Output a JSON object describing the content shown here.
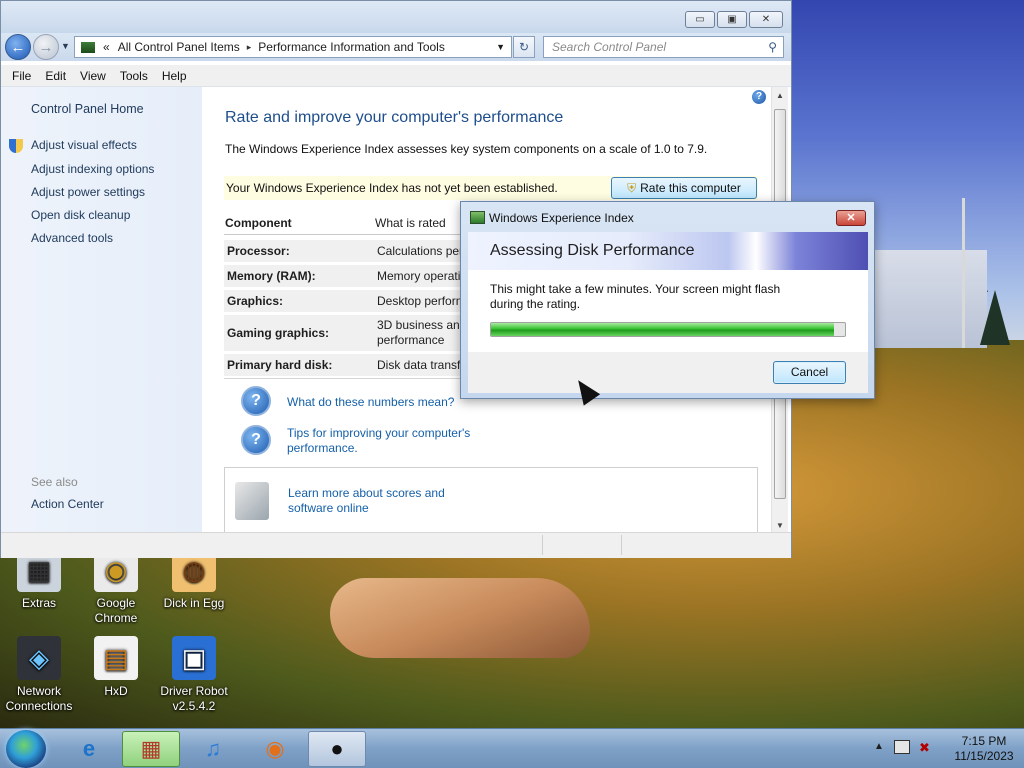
{
  "window": {
    "controls": {
      "minimize": "▭",
      "maximize": "▣",
      "close": "✕"
    },
    "address": {
      "prefix": "«",
      "crumbs": [
        "All Control Panel Items",
        "Performance Information and Tools"
      ],
      "separator": "▸"
    },
    "search": {
      "placeholder": "Search Control Panel"
    },
    "menu": [
      "File",
      "Edit",
      "View",
      "Tools",
      "Help"
    ]
  },
  "sidebar": {
    "home": "Control Panel Home",
    "links": [
      "Adjust visual effects",
      "Adjust indexing options",
      "Adjust power settings",
      "Open disk cleanup",
      "Advanced tools"
    ],
    "see_also_label": "See also",
    "see_also_links": [
      "Action Center"
    ]
  },
  "main": {
    "title": "Rate and improve your computer's performance",
    "description": "The Windows Experience Index assesses key system components on a scale of 1.0 to 7.9.",
    "notice": "Your Windows Experience Index has not yet been established.",
    "rate_button": "Rate this computer",
    "table": {
      "headers": [
        "Component",
        "What is rated"
      ],
      "rows": [
        {
          "component": "Processor:",
          "rated": "Calculations per"
        },
        {
          "component": "Memory (RAM):",
          "rated": "Memory operatio"
        },
        {
          "component": "Graphics:",
          "rated": "Desktop perform"
        },
        {
          "component": "Gaming graphics:",
          "rated": "3D business and",
          "rated2": "performance"
        },
        {
          "component": "Primary hard disk:",
          "rated": "Disk data transfe"
        }
      ]
    },
    "help_links": [
      {
        "text": "What do these numbers mean?"
      },
      {
        "text": "Tips for improving your computer's",
        "text2": "performance."
      }
    ],
    "learn_more": {
      "line1": "Learn more about scores and",
      "line2": "software online"
    }
  },
  "dialog": {
    "title": "Windows Experience Index",
    "heading": "Assessing Disk Performance",
    "message_line1": "This might take a few minutes. Your screen might flash",
    "message_line2": "during the rating.",
    "progress": 0.97,
    "cancel": "Cancel"
  },
  "desktop_icons": [
    {
      "label": "Extras",
      "glyph": "▦"
    },
    {
      "label": "Google Chrome",
      "glyph": "◉"
    },
    {
      "label": "Dick in Egg",
      "glyph": "◍"
    },
    {
      "label": "Network Connections",
      "glyph": "◈"
    },
    {
      "label": "HxD",
      "glyph": "▤"
    },
    {
      "label": "Driver Robot v2.5.4.2",
      "glyph": "▣"
    }
  ],
  "taskbar": {
    "items": [
      "Internet Explorer",
      "Control Panel",
      "iTunes",
      "Firefox",
      "App"
    ],
    "clock_time": "7:15 PM",
    "clock_date": "11/15/2023"
  }
}
